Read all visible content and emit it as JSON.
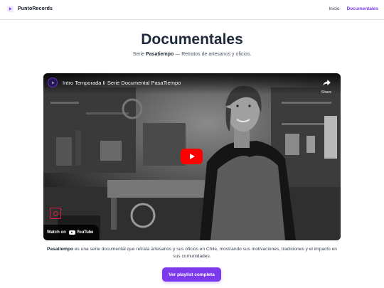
{
  "nav": {
    "brand": "PuntoRecords",
    "links": [
      {
        "label": "Inicio",
        "active": false
      },
      {
        "label": "Documentales",
        "active": true
      }
    ]
  },
  "header": {
    "title": "Documentales",
    "subtitle_prefix": "Serie ",
    "subtitle_series": "Pasatiempo",
    "subtitle_rest": " — Retratos de artesanos y oficios."
  },
  "video": {
    "title": "Intro Temporada II Serie Documental PasaTiempo",
    "share_label": "Share",
    "watch_on": "Watch on",
    "platform": "YouTube",
    "play_icon": "play-icon"
  },
  "description": {
    "series": "Pasatiempo",
    "text": " es una serie documental que retrata artesanos y sus oficios en Chile, mostrando sus motivaciones, tradiciones y el impacto en sus comunidades."
  },
  "cta": {
    "label": "Ver playlist completa"
  },
  "colors": {
    "accent": "#7c3aed",
    "play": "#ff0000",
    "title": "#1e293b"
  }
}
